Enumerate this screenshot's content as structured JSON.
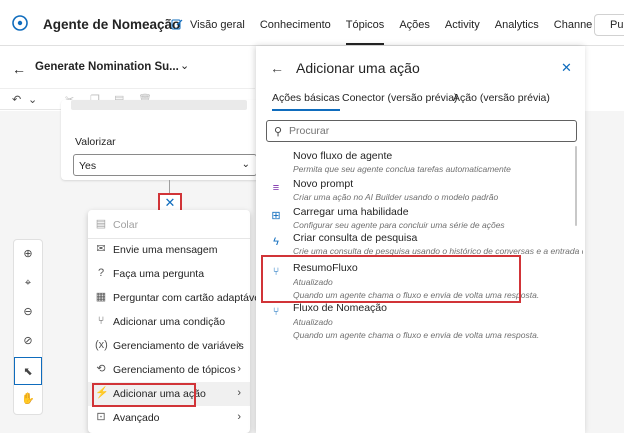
{
  "app": {
    "title": "Agente de Nomeação"
  },
  "nav": {
    "items": [
      "Visão geral",
      "Conhecimento",
      "Tópicos",
      "Ações",
      "Activity",
      "Analytics",
      "Channe"
    ],
    "active_index": 2
  },
  "publish_label": "Pul",
  "topic": {
    "title": "Generate Nomination Su..."
  },
  "node": {
    "valorizar_label": "Valorizar",
    "valorizar_value": "Yes"
  },
  "context_menu": {
    "items": [
      {
        "label": "Colar",
        "icon": "paste-icon",
        "disabled": true
      },
      {
        "label": "Envie uma mensagem",
        "icon": "message-icon"
      },
      {
        "label": "Faça uma pergunta",
        "icon": "question-icon"
      },
      {
        "label": "Perguntar com cartão adaptável",
        "icon": "card-icon"
      },
      {
        "label": "Adicionar uma condição",
        "icon": "branch-icon"
      },
      {
        "label": "Gerenciamento de variáveis",
        "icon": "variable-icon",
        "submenu": true
      },
      {
        "label": "Gerenciamento de tópicos",
        "icon": "topic-icon",
        "submenu": true
      },
      {
        "label": "Adicionar uma ação",
        "icon": "action-icon",
        "submenu": true
      },
      {
        "label": "Avançado",
        "icon": "advanced-icon",
        "submenu": true
      }
    ]
  },
  "panel": {
    "title": "Adicionar uma ação",
    "tabs": [
      "Ações básicas",
      "Conector (versão prévia)",
      "Ação (versão prévia)"
    ],
    "active_tab": 0,
    "search_placeholder": "Procurar",
    "actions": [
      {
        "name": "Novo fluxo de agente",
        "sub": "",
        "desc": "Permita que seu agente conclua tarefas automaticamente"
      },
      {
        "name": "Novo prompt",
        "sub": "",
        "desc": "Criar uma ação no AI Builder usando o modelo padrão"
      },
      {
        "name": "Carregar uma habilidade",
        "sub": "",
        "desc": "Configurar seu agente para concluir uma série de ações"
      },
      {
        "name": "Criar consulta de pesquisa",
        "sub": "",
        "desc": "Crie uma consulta de pesquisa usando o histórico de conversas e a entrada do us..."
      },
      {
        "name": "ResumoFluxo",
        "sub": "Atualizado",
        "desc": "Quando um agente chama o fluxo e envia de volta uma resposta."
      },
      {
        "name": "Fluxo de Nomeação",
        "sub": "Atualizado",
        "desc": "Quando um agente chama o fluxo e envia de volta uma resposta."
      }
    ]
  },
  "colors": {
    "accent": "#0f6cbd",
    "highlight_box": "#d13438"
  }
}
